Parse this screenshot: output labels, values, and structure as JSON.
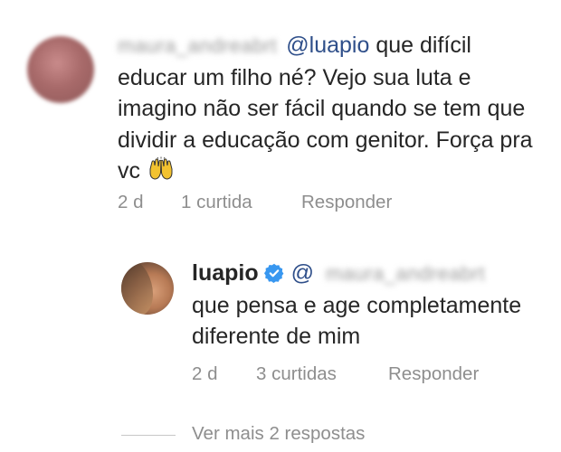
{
  "comment_1": {
    "username": "maura_andreabrt",
    "mention": "@luapio",
    "text_line_1": " que difícil",
    "text_rest": "educar um filho né? Vejo sua luta e imagino não ser fácil quando se tem que dividir a educação com genitor. Força pra vc",
    "emoji": "raising-hands-emoji",
    "time": "2 d",
    "likes": "1 curtida",
    "reply_label": "Responder"
  },
  "comment_2": {
    "username": "luapio",
    "verified_icon": "verified-badge-icon",
    "mention_prefix": "@",
    "mention_username": "maura_andreabrt",
    "text": "que pensa e age completamente diferente de mim",
    "time": "2 d",
    "likes": "3 curtidas",
    "reply_label": "Responder"
  },
  "view_more": {
    "label": "Ver mais 2 respostas"
  },
  "colors": {
    "mention": "#2f4f8a",
    "meta": "#8e8e8e",
    "verified": "#3897f0",
    "text": "#262626"
  }
}
